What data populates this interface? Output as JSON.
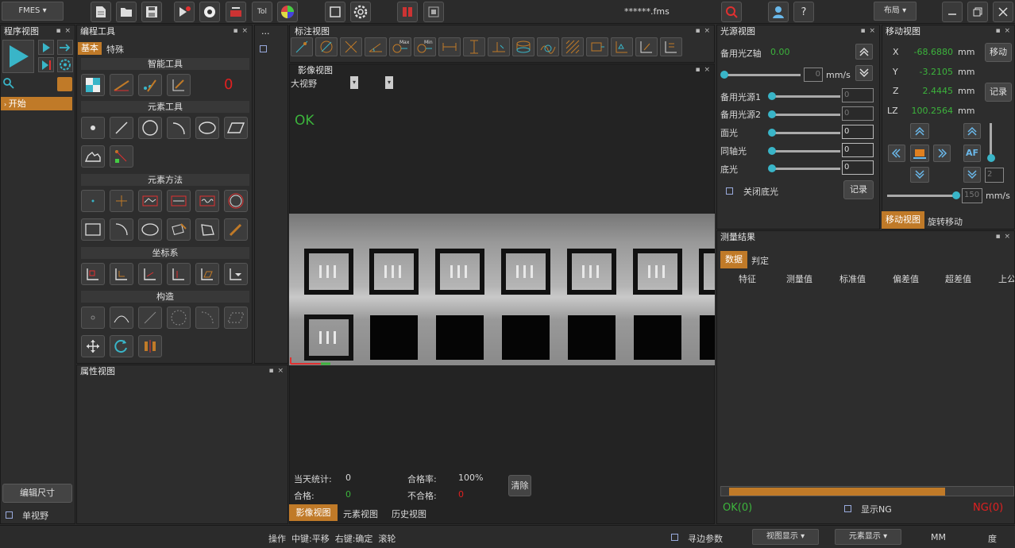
{
  "toolbar": {
    "app_menu": "FMES",
    "file_name": "******.fms",
    "layout_menu": "布局"
  },
  "program_view": {
    "title": "程序视图",
    "tree_item": "开始",
    "edit_size": "编辑尺寸",
    "single_view": "单视野"
  },
  "programming_tools": {
    "title": "编程工具",
    "tabs": [
      "基本",
      "特殊"
    ],
    "sections": {
      "smart": "智能工具",
      "element": "元素工具",
      "method": "元素方法",
      "coordinate": "坐标系",
      "construct": "构造"
    },
    "count": "0"
  },
  "small_panel": {
    "title": "..."
  },
  "property_view": {
    "title": "属性视图"
  },
  "annotation_view": {
    "title": "标注视图"
  },
  "image_view": {
    "title": "影像视图",
    "view_select": "大视野",
    "ok_text": "OK",
    "stats": {
      "today_label": "当天统计:",
      "today_value": "0",
      "pass_rate_label": "合格率:",
      "pass_rate_value": "100%",
      "pass_label": "合格:",
      "pass_value": "0",
      "fail_label": "不合格:",
      "fail_value": "0",
      "clear": "清除"
    },
    "bottom_tabs": [
      "影像视图",
      "元素视图",
      "历史视图"
    ]
  },
  "light_view": {
    "title": "光源视图",
    "z_axis_label": "备用光Z轴",
    "z_axis_value": "0.00",
    "speed_value": "0",
    "speed_unit": "mm/s",
    "sources": [
      {
        "label": "备用光源1",
        "value": "0"
      },
      {
        "label": "备用光源2",
        "value": "0"
      },
      {
        "label": "面光",
        "value": "0"
      },
      {
        "label": "同轴光",
        "value": "0"
      },
      {
        "label": "底光",
        "value": "0"
      }
    ],
    "close_bottom": "关闭底光",
    "record": "记录"
  },
  "move_view": {
    "title": "移动视图",
    "axes": [
      {
        "name": "X",
        "value": "-68.6880",
        "unit": "mm"
      },
      {
        "name": "Y",
        "value": "-3.2105",
        "unit": "mm"
      },
      {
        "name": "Z",
        "value": "2.4445",
        "unit": "mm"
      },
      {
        "name": "LZ",
        "value": "100.2564",
        "unit": "mm"
      }
    ],
    "move_btn": "移动",
    "record_btn": "记录",
    "af_btn": "AF",
    "step_value": "2",
    "speed_value": "150",
    "speed_unit": "mm/s",
    "tabs": [
      "移动视图",
      "旋转移动"
    ]
  },
  "results": {
    "title": "测量结果",
    "tabs": [
      "数据",
      "判定"
    ],
    "columns": [
      "特征",
      "测量值",
      "标准值",
      "偏差值",
      "超差值",
      "上公"
    ],
    "ok_count": "OK(0)",
    "ng_count": "NG(0)",
    "show_ng": "显示NG"
  },
  "statusbar": {
    "hint": "操作  中键:平移  右键:确定  滚轮",
    "edge_param": "寻边参数",
    "view_display": "视图显示",
    "element_display": "元素显示",
    "unit_mm": "MM",
    "unit_deg": "度"
  },
  "colors": {
    "accent": "#c07a28",
    "ok": "#3cb43c",
    "ng": "#e02020",
    "teal": "#39b5c8"
  }
}
